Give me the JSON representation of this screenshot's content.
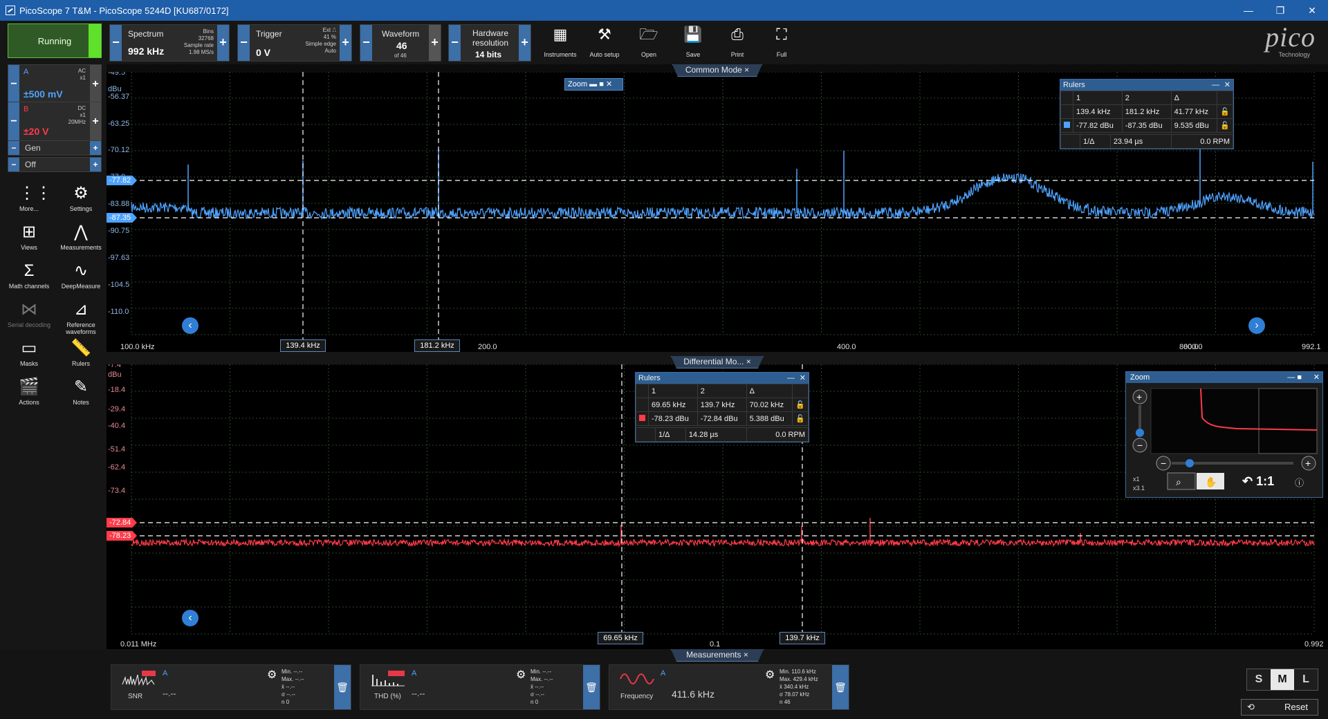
{
  "window": {
    "title": "PicoScope 7 T&M  - PicoScope 5244D [KU687/0172]",
    "min": "—",
    "max": "❐",
    "close": "✕"
  },
  "toolbar": {
    "spectrum": {
      "title": "Spectrum",
      "value": "992 kHz",
      "bins_label": "Bins",
      "bins_value": "32768",
      "rate_label": "Sample rate",
      "rate_value": "1.98 MS/s"
    },
    "trigger": {
      "title": "Trigger",
      "value": "0 V",
      "src": "Ext",
      "pct": "41 %",
      "type": "Simple edge",
      "mode": "Auto"
    },
    "waveform": {
      "title": "Waveform",
      "value": "46",
      "of": "of 46"
    },
    "resolution": {
      "title": "Hardware resolution",
      "value": "14 bits"
    },
    "buttons": [
      {
        "label": "Instruments"
      },
      {
        "label": "Auto setup"
      },
      {
        "label": "Open"
      },
      {
        "label": "Save"
      },
      {
        "label": "Print"
      },
      {
        "label": "Full"
      }
    ],
    "logo": {
      "name": "pico",
      "sub": "Technology"
    }
  },
  "left": {
    "run": "Running",
    "chanA": {
      "name": "A",
      "coupling": "AC",
      "probe": "x1",
      "range": "±500 mV",
      "color": "#4ea3ff"
    },
    "chanB": {
      "name": "B",
      "coupling": "DC",
      "probe": "x1",
      "bw": "20MHz",
      "range": "±20 V",
      "color": "#ff3b4a"
    },
    "gen": "Gen",
    "off": "Off",
    "tools": [
      {
        "label": "More..."
      },
      {
        "label": "Settings"
      },
      {
        "label": "Views"
      },
      {
        "label": "Measurements"
      },
      {
        "label": "Math channels"
      },
      {
        "label": "DeepMeasure"
      },
      {
        "label": "Serial decoding"
      },
      {
        "label": "Reference waveforms"
      },
      {
        "label": "Masks"
      },
      {
        "label": "Rulers"
      },
      {
        "label": "Actions"
      },
      {
        "label": "Notes"
      }
    ]
  },
  "pane1": {
    "tab": "Common Mode",
    "zoom_label": "Zoom",
    "y_unit": "dBu",
    "y_ticks": [
      "-49.5",
      "-56.37",
      "-63.25",
      "-70.12",
      "-77.0",
      "-83.88",
      "-90.75",
      "-97.63",
      "-104.5",
      "-110.0"
    ],
    "x_ticks": [
      "100.0 kHz",
      "200.0",
      "400.0",
      "600.0",
      "800.0",
      "992.1"
    ],
    "ruler1": "139.4 kHz",
    "ruler2": "181.2 kHz",
    "ymark1": "-77.82",
    "ymark2": "-87.35",
    "rulers": {
      "title": "Rulers",
      "h1": "1",
      "h2": "2",
      "hd": "Δ",
      "f1": "139.4 kHz",
      "f2": "181.2 kHz",
      "fd": "41.77 kHz",
      "a1": "-77.82 dBu",
      "a2": "-87.35 dBu",
      "ad": "9.535 dBu",
      "inv": "1/Δ",
      "inv_val": "23.94 µs",
      "rpm": "0.0 RPM"
    },
    "nav_left": "‹",
    "nav_right": "›"
  },
  "pane2": {
    "tab": "Differential Mo...",
    "y_unit": "dBu",
    "y_ticks": [
      "-7.4",
      "-18.4",
      "-29.4",
      "-40.4",
      "-51.4",
      "-62.4",
      "-73.4"
    ],
    "x_ticks": [
      "0.011 MHz",
      "0.1",
      "0.992"
    ],
    "ruler1": "69.65 kHz",
    "ruler2": "139.7 kHz",
    "ymark1": "-72.84",
    "ymark2": "-78.23",
    "rulers": {
      "title": "Rulers",
      "h1": "1",
      "h2": "2",
      "hd": "Δ",
      "f1": "69.65 kHz",
      "f2": "139.7 kHz",
      "fd": "70.02 kHz",
      "a1": "-78.23 dBu",
      "a2": "-72.84 dBu",
      "ad": "5.388 dBu",
      "inv": "1/Δ",
      "inv_val": "14.28 µs",
      "rpm": "0.0 RPM"
    },
    "zoom": {
      "title": "Zoom",
      "x1": "x1",
      "x3": "x3.1",
      "ratio": "1:1"
    },
    "nav_left": "‹"
  },
  "measurements": {
    "tab": "Measurements",
    "cards": [
      {
        "name": "SNR",
        "ch": "A",
        "value": "--.--",
        "min": "--.--",
        "max": "--.--",
        "avg": "--.--",
        "sd": "--.--",
        "n": "0"
      },
      {
        "name": "THD (%)",
        "ch": "A",
        "value": "--.--",
        "min": "--.--",
        "max": "--.--",
        "avg": "--.--",
        "sd": "--.--",
        "n": "0"
      },
      {
        "name": "Frequency",
        "ch": "A",
        "value": "411.6 kHz",
        "min": "110.6 kHz",
        "max": "429.4 kHz",
        "avg": "340.4 kHz",
        "sd": "78.07 kHz",
        "n": "46"
      }
    ],
    "stat_labels": {
      "min": "Min.",
      "max": "Max.",
      "avg": "x̄",
      "sd": "σ",
      "n": "n"
    },
    "sizes": [
      "S",
      "M",
      "L"
    ],
    "reset": "Reset"
  }
}
